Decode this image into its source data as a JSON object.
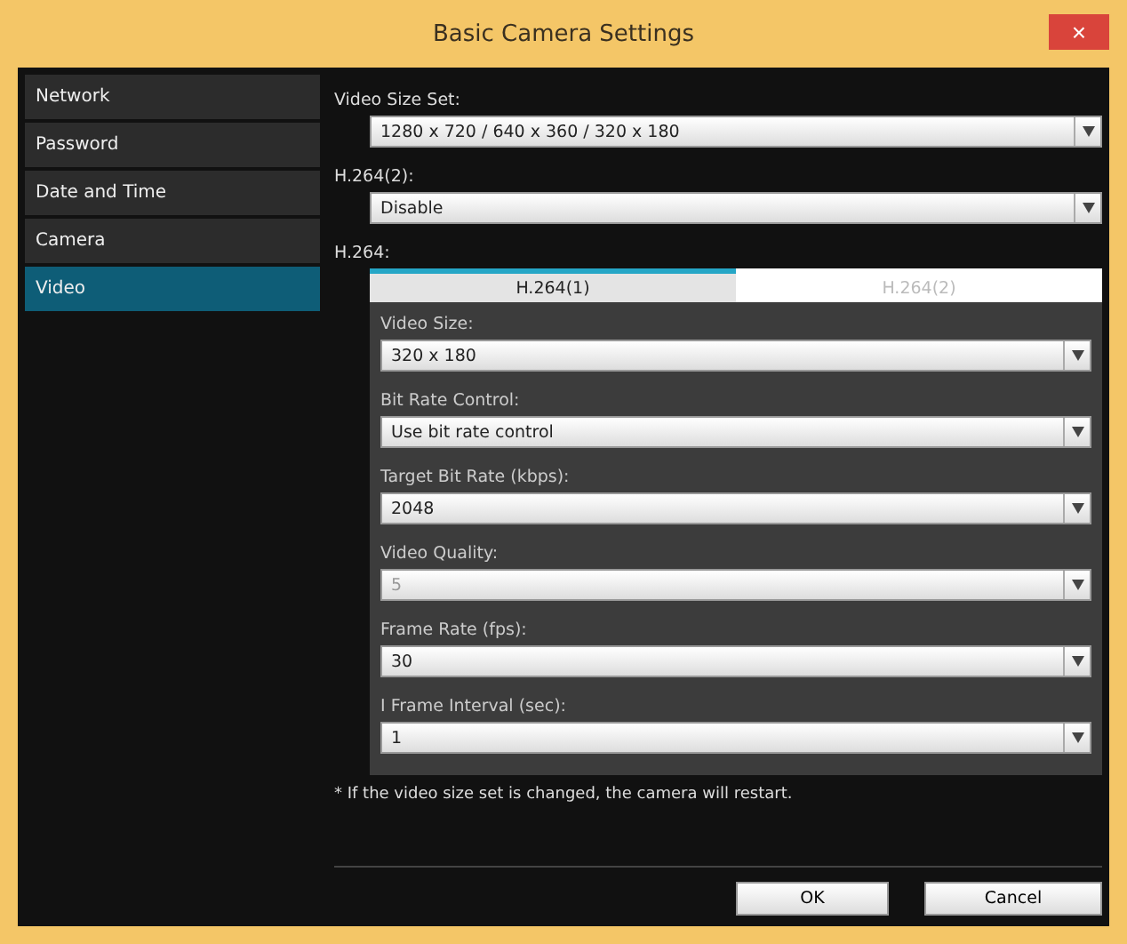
{
  "window": {
    "title": "Basic Camera Settings",
    "close": "×"
  },
  "sidebar": {
    "items": [
      {
        "label": "Network",
        "selected": false
      },
      {
        "label": "Password",
        "selected": false
      },
      {
        "label": "Date and Time",
        "selected": false
      },
      {
        "label": "Camera",
        "selected": false
      },
      {
        "label": "Video",
        "selected": true
      }
    ]
  },
  "fields": [
    {
      "label": "Video Size Set:",
      "value": "1280 x 720 / 640 x 360 / 320 x 180",
      "disabled": false
    },
    {
      "label": "H.264(2):",
      "value": "Disable",
      "disabled": false
    }
  ],
  "h264": {
    "label": "H.264:",
    "tabs": [
      {
        "label": "H.264(1)",
        "selected": true,
        "disabled": false
      },
      {
        "label": "H.264(2)",
        "selected": false,
        "disabled": true
      }
    ],
    "fields": [
      {
        "label": "Video Size:",
        "value": "320 x 180",
        "disabled": false
      },
      {
        "label": "Bit Rate Control:",
        "value": "Use bit rate control",
        "disabled": false
      },
      {
        "label": "Target Bit Rate (kbps):",
        "value": "2048",
        "disabled": false
      },
      {
        "label": "Video Quality:",
        "value": "5",
        "disabled": true
      },
      {
        "label": "Frame Rate (fps):",
        "value": "30",
        "disabled": false
      },
      {
        "label": "I Frame Interval (sec):",
        "value": "1",
        "disabled": false
      }
    ]
  },
  "note": "* If the video size set is changed, the camera will restart.",
  "buttons": [
    "OK",
    "Cancel"
  ]
}
